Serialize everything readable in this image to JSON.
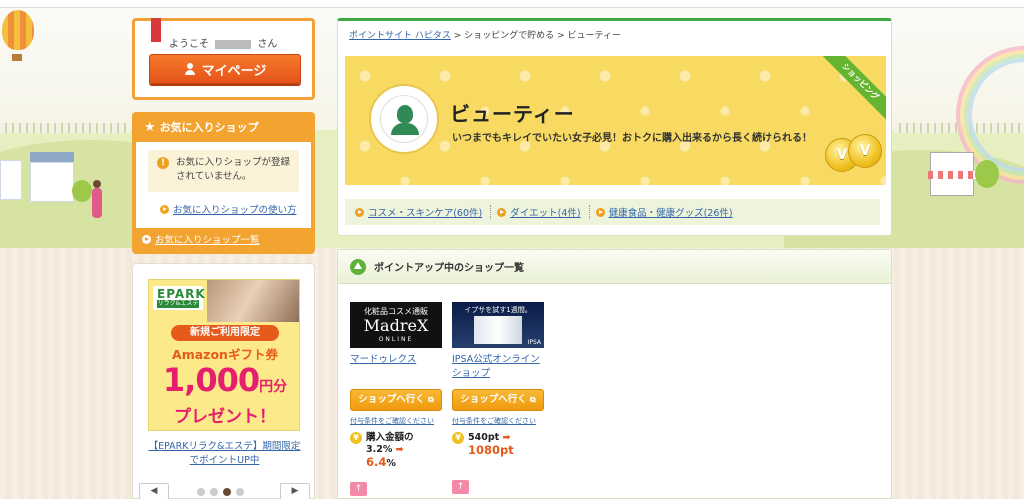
{
  "header": {
    "welcome_prefix": "ようこそ",
    "welcome_suffix": "さん",
    "mypage_label": "マイページ"
  },
  "favorites": {
    "title": "お気に入りショップ",
    "notice": "お気に入りショップが登録されていません。",
    "howto_link": "お気に入りショップの使い方",
    "list_link": "お気に入りショップ一覧"
  },
  "banner": {
    "logo_main": "EPARK",
    "logo_sub": "リラク&エステ",
    "limited": "新規ご利用限定",
    "amazon": "Amazonギフト券",
    "amount": "1,000",
    "amount_unit": "円分",
    "present": "プレゼント！",
    "caption": "【EPARKリラク&エステ】期間限定でポイントUP中",
    "carousel_prev": "◀",
    "carousel_next": "▶",
    "carousel_dots": 4,
    "carousel_active_index": 2
  },
  "breadcrumb": {
    "items": [
      "ポイントサイト ハピタス",
      "ショッピングで貯める",
      "ビューティー"
    ],
    "separator": ">"
  },
  "hero": {
    "title": "ビューティー",
    "subtitle": "いつまでもキレイでいたい女子必見！おトクに購入出来るから長く続けられる！",
    "ribbon": "ショッピング",
    "coin_left": "V",
    "coin_right": "V"
  },
  "subcategories": [
    {
      "label": "コスメ・スキンケア(60件)"
    },
    {
      "label": "ダイエット(4件)"
    },
    {
      "label": "健康食品・健康グッズ(26件)"
    }
  ],
  "pointup": {
    "title": "ポイントアップ中のショップ一覧",
    "shops": [
      {
        "logo_top": "化粧品コスメ通販",
        "logo_main": "MadreX",
        "logo_bottom": "ONLINE",
        "name": "マードゥレクス",
        "button": "ショップへ行く",
        "conditions": "付与条件をご確認ください",
        "reward_line1": "購入金額の",
        "reward_old": "3.2%",
        "reward_new": "6.4",
        "reward_new_unit": "%"
      },
      {
        "logo_top": "イプサを試す1週間。",
        "logo_mark": "IPSA",
        "name": "IPSA公式オンラインショップ",
        "button": "ショップへ行く",
        "conditions": "付与条件をご確認ください",
        "reward_old": "540pt",
        "reward_new": "1080pt"
      }
    ]
  },
  "colors": {
    "accent_orange": "#f3a330",
    "accent_green": "#3ea842",
    "link_blue": "#3366aa",
    "hero_yellow": "#f8d961"
  }
}
